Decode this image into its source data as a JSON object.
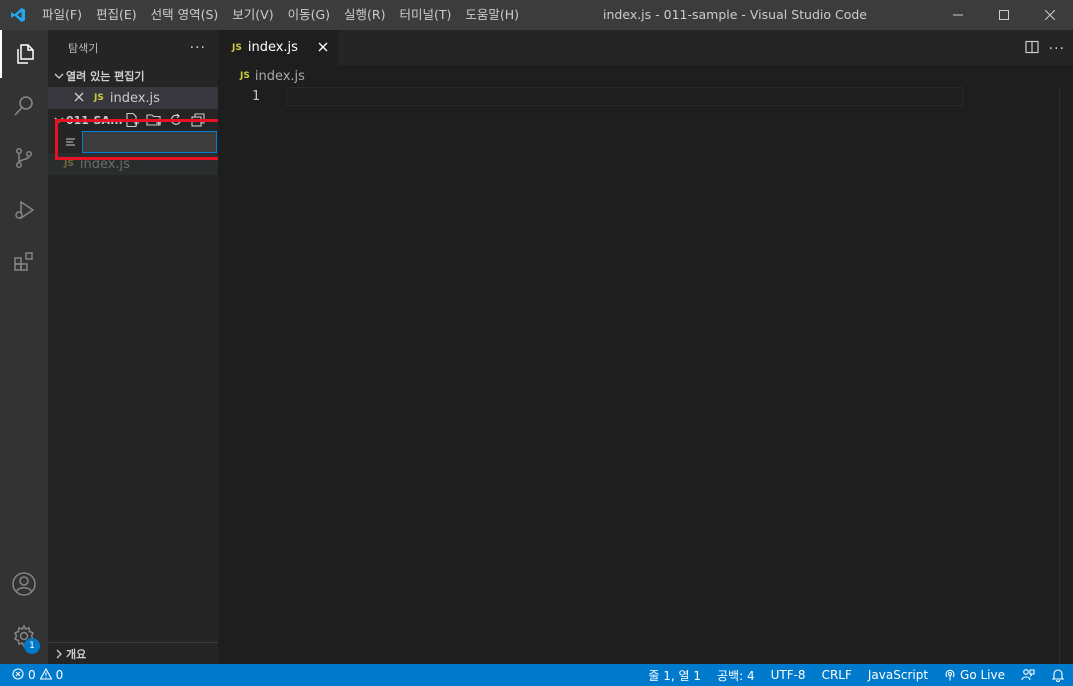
{
  "titlebar": {
    "menu": [
      "파일(F)",
      "편집(E)",
      "선택 영역(S)",
      "보기(V)",
      "이동(G)",
      "실행(R)",
      "터미널(T)",
      "도움말(H)"
    ],
    "window_title": "index.js - 011-sample - Visual Studio Code"
  },
  "sidebar": {
    "title": "탐색기",
    "more": "···",
    "open_editors_label": "열려 있는 편집기",
    "open_editor_file": "index.js",
    "folder_label": "011-SA...",
    "new_file_value": "",
    "file_name": "index.js",
    "outline_label": "개요"
  },
  "editor": {
    "tab_label": "index.js",
    "breadcrumb_file": "index.js",
    "line_numbers": [
      "1"
    ],
    "file_badge": "JS"
  },
  "activity": {
    "settings_badge": "1"
  },
  "statusbar": {
    "errors": "0",
    "warnings": "0",
    "position": "줄 1, 열 1",
    "indent": "공백: 4",
    "encoding": "UTF-8",
    "eol": "CRLF",
    "language": "JavaScript",
    "golive": "Go Live"
  },
  "colors": {
    "accent": "#007acc",
    "highlight": "#e81123",
    "js": "#cbcb41"
  }
}
